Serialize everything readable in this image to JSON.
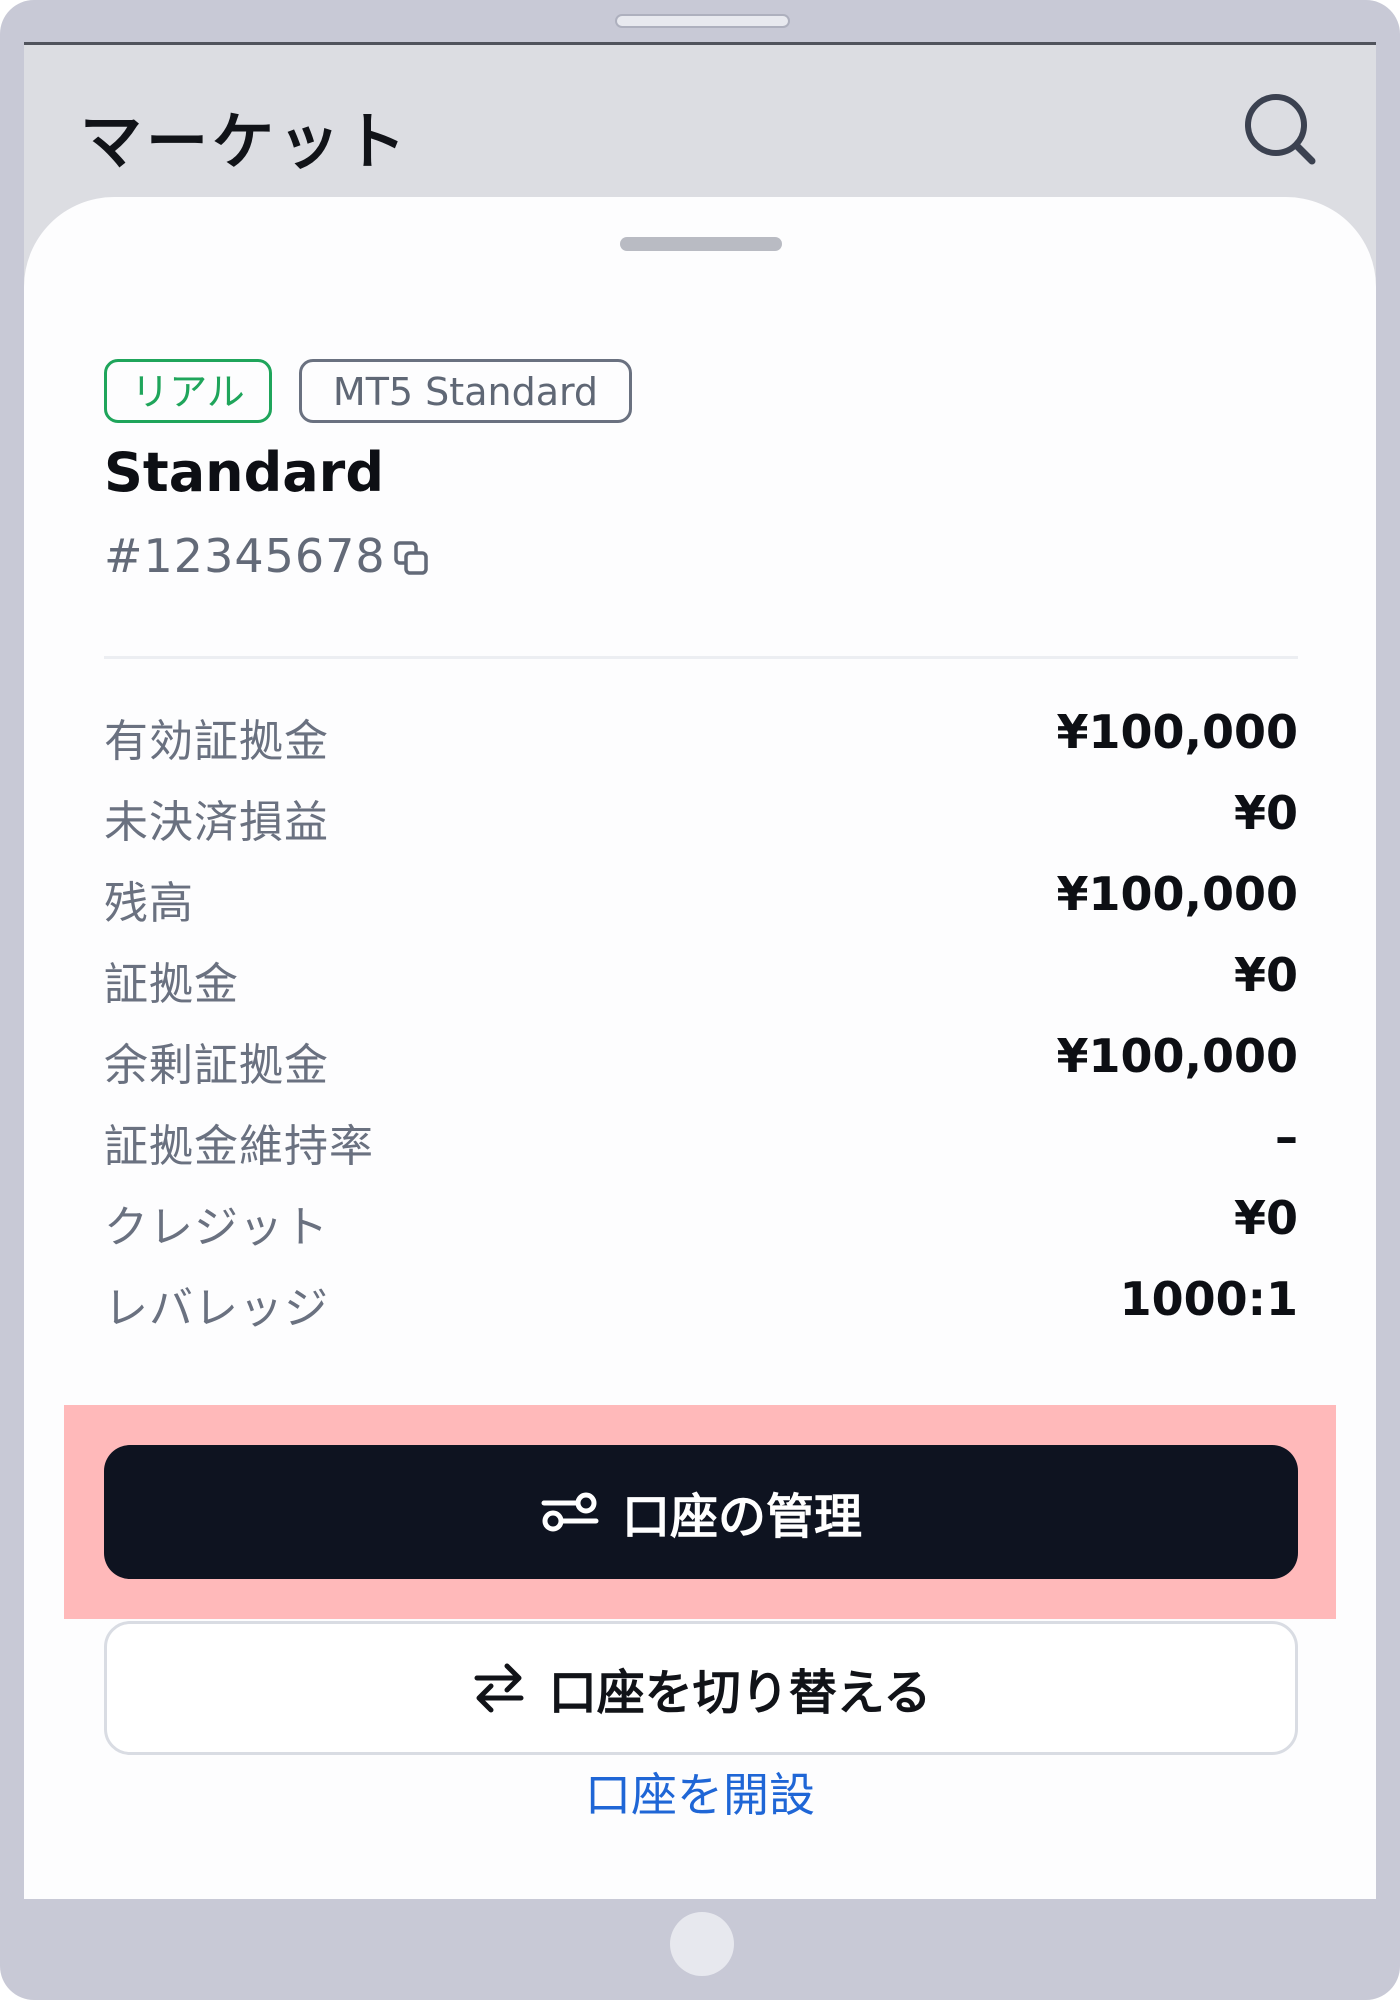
{
  "header": {
    "title": "マーケット"
  },
  "icons": {
    "search": "search-icon",
    "copy": "copy-icon",
    "manage": "settings-sliders-icon",
    "switch": "swap-arrows-icon"
  },
  "account": {
    "tags": {
      "real": "リアル",
      "type": "MT5 Standard"
    },
    "name": "Standard",
    "number": "#12345678"
  },
  "details": [
    {
      "label": "有効証拠金",
      "value": "¥100,000"
    },
    {
      "label": "未決済損益",
      "value": "¥0"
    },
    {
      "label": "残高",
      "value": "¥100,000"
    },
    {
      "label": "証拠金",
      "value": "¥0"
    },
    {
      "label": "余剰証拠金",
      "value": "¥100,000"
    },
    {
      "label": "証拠金維持率",
      "value": "–"
    },
    {
      "label": "クレジット",
      "value": "¥0"
    },
    {
      "label": "レバレッジ",
      "value": "1000:1"
    }
  ],
  "actions": {
    "manage_label": "口座の管理",
    "switch_label": "口座を切り替える",
    "open_label": "口座を開設"
  },
  "colors": {
    "real_tag": "#1fa55b",
    "primary_button": "#0e1320",
    "link": "#1f66d6",
    "highlight": "#ffb9ba"
  }
}
